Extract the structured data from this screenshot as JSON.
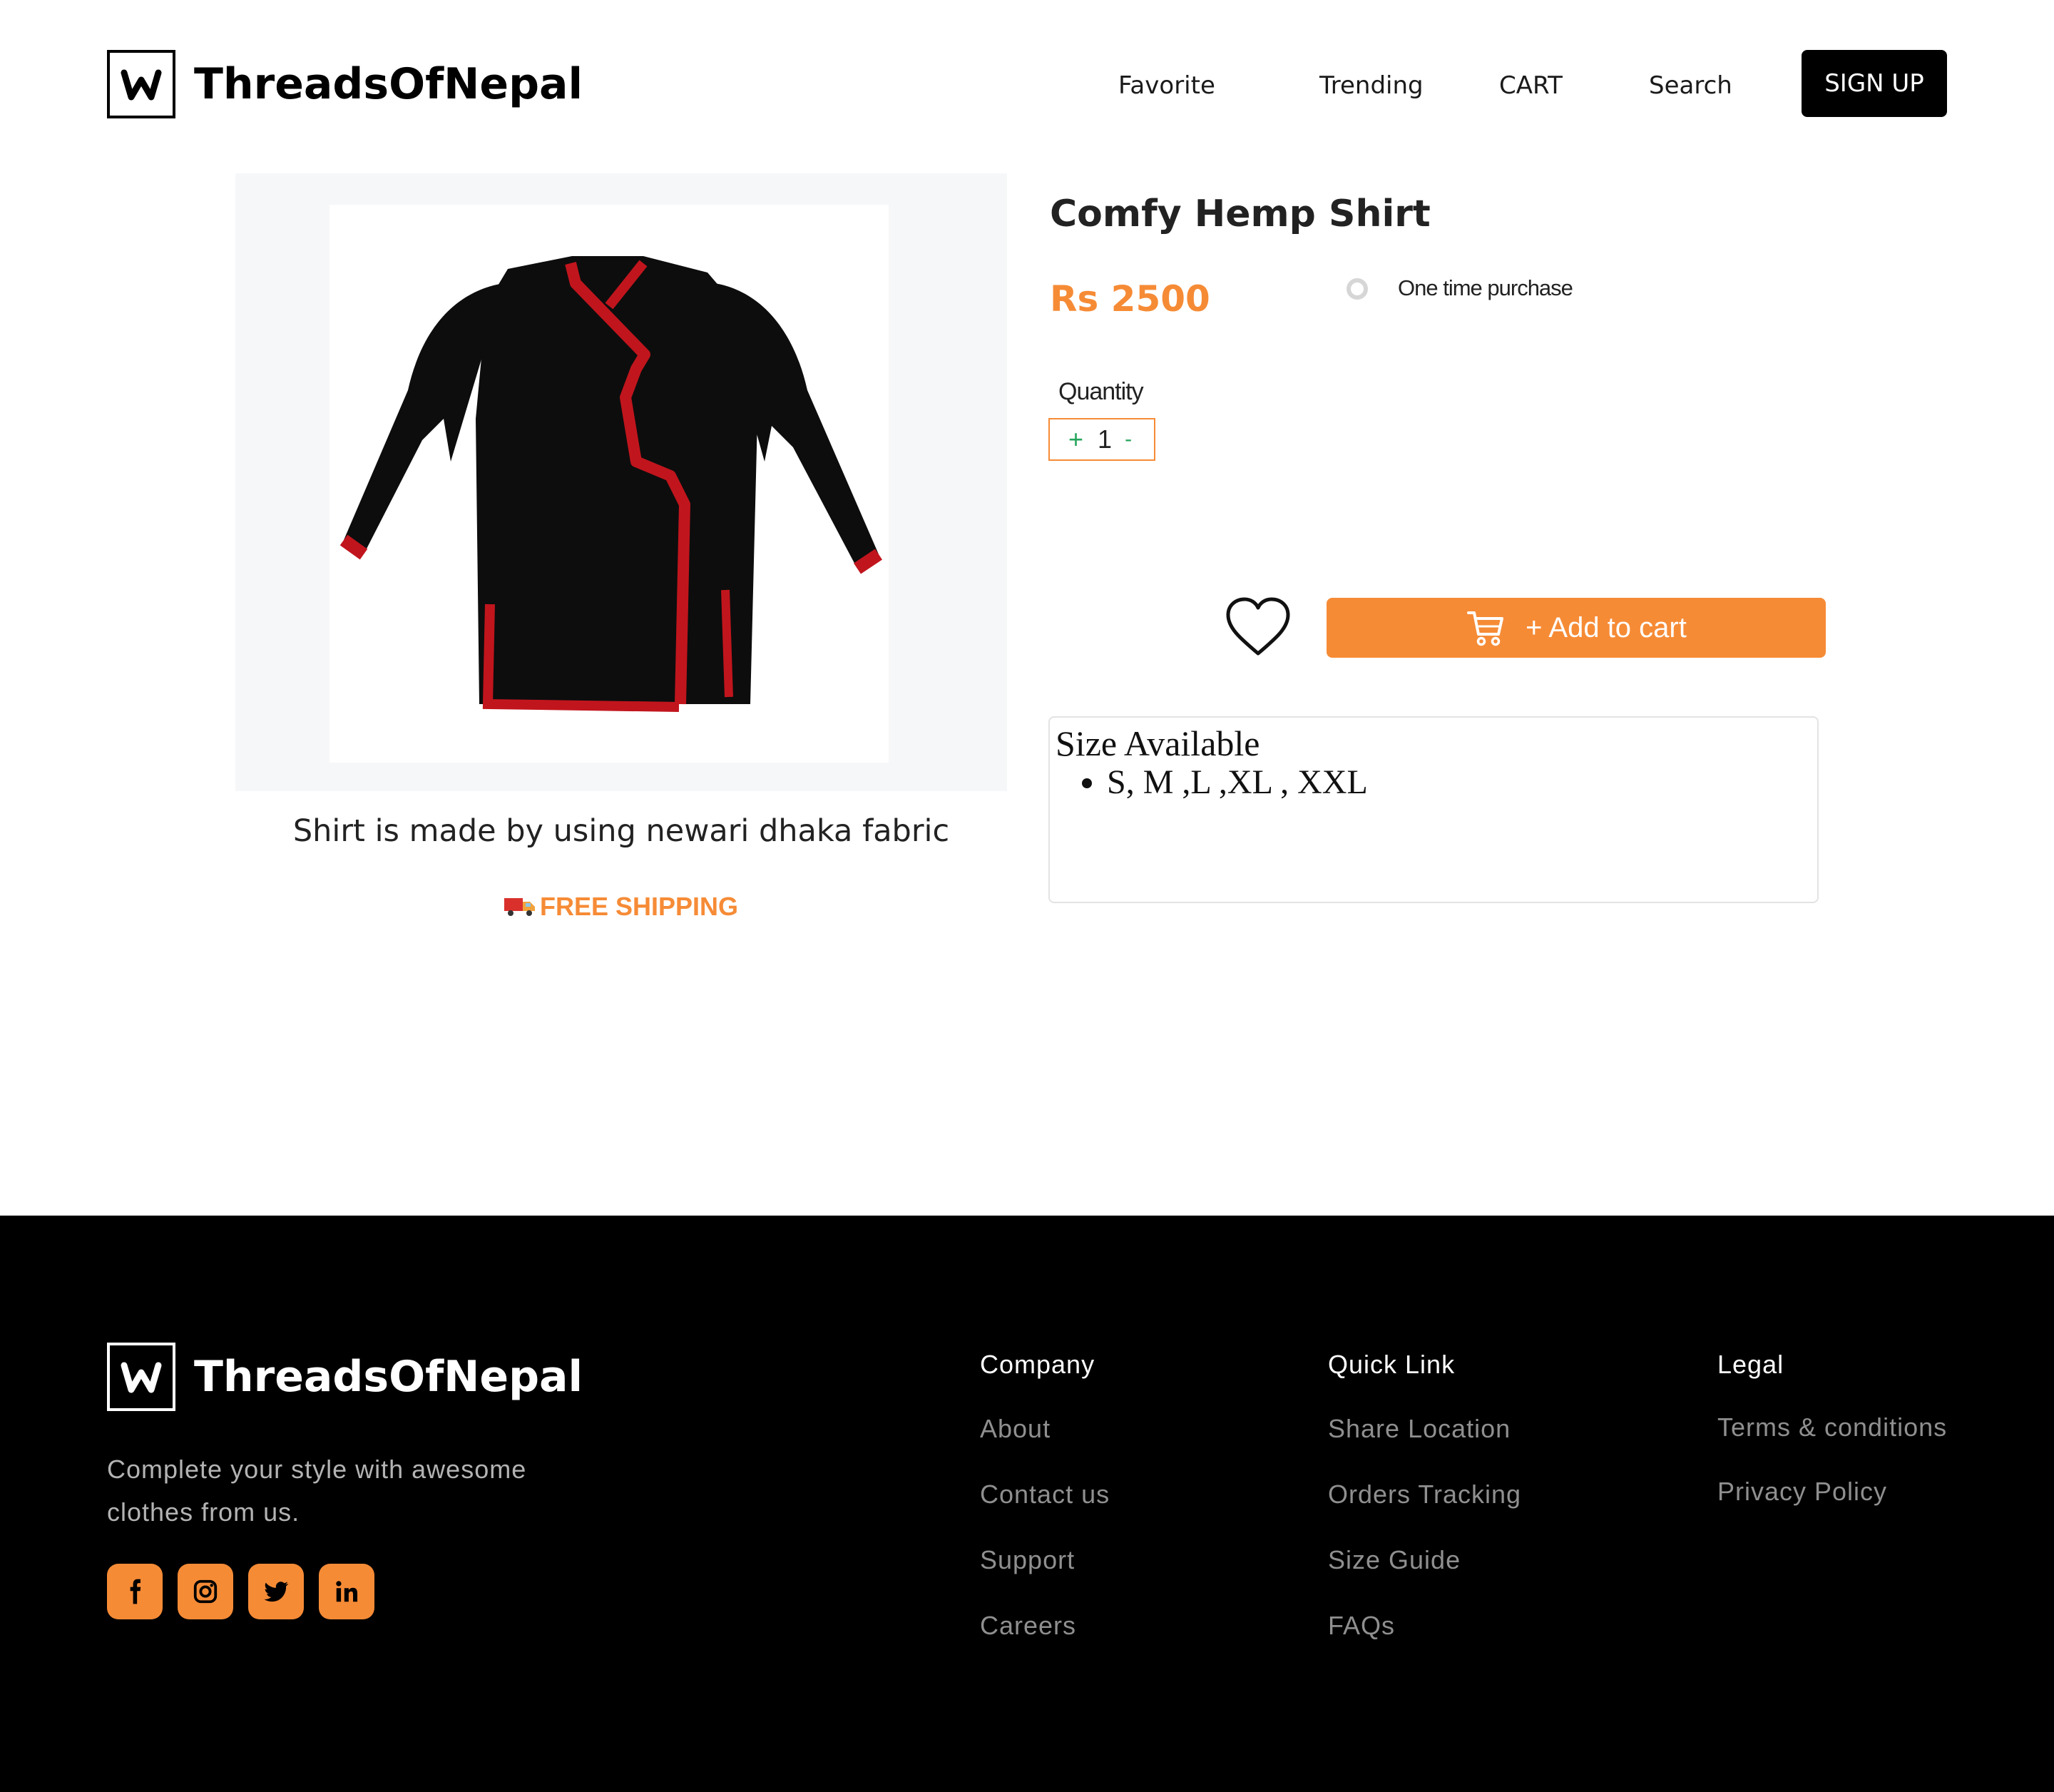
{
  "header": {
    "brand": "ThreadsOfNepal",
    "nav": {
      "favorite": "Favorite",
      "trending": "Trending",
      "cart": "CART",
      "search": "Search"
    },
    "signup_label": "SIGN UP"
  },
  "product": {
    "title": "Comfy Hemp Shirt",
    "price": "Rs 2500",
    "purchase_option": "One time purchase",
    "quantity_label": "Quantity",
    "quantity": {
      "plus": "+",
      "value": "1",
      "minus": "-"
    },
    "add_to_cart_label": "+ Add to cart",
    "description": "Shirt is made by using newari dhaka fabric",
    "shipping": "FREE SHIPPING",
    "sizes_title": "Size Available",
    "sizes": [
      "S, M ,L ,XL , XXL"
    ]
  },
  "footer": {
    "brand": "ThreadsOfNepal",
    "tagline": "Complete your style with awesome clothes from us.",
    "social": [
      "facebook-icon",
      "instagram-icon",
      "twitter-icon",
      "linkedin-icon"
    ],
    "company": {
      "title": "Company",
      "links": [
        "About",
        "Contact us",
        "Support",
        "Careers"
      ]
    },
    "quick_link": {
      "title": "Quick Link",
      "links": [
        "Share Location",
        "Orders Tracking",
        "Size Guide",
        "FAQs"
      ]
    },
    "legal": {
      "title": "Legal",
      "links": [
        "Terms & conditions",
        "Privacy Policy"
      ]
    }
  },
  "colors": {
    "accent": "#f68b36",
    "footer_bg": "#000000",
    "qty_green": "#27a55d",
    "shirt_red": "#c1151d"
  }
}
